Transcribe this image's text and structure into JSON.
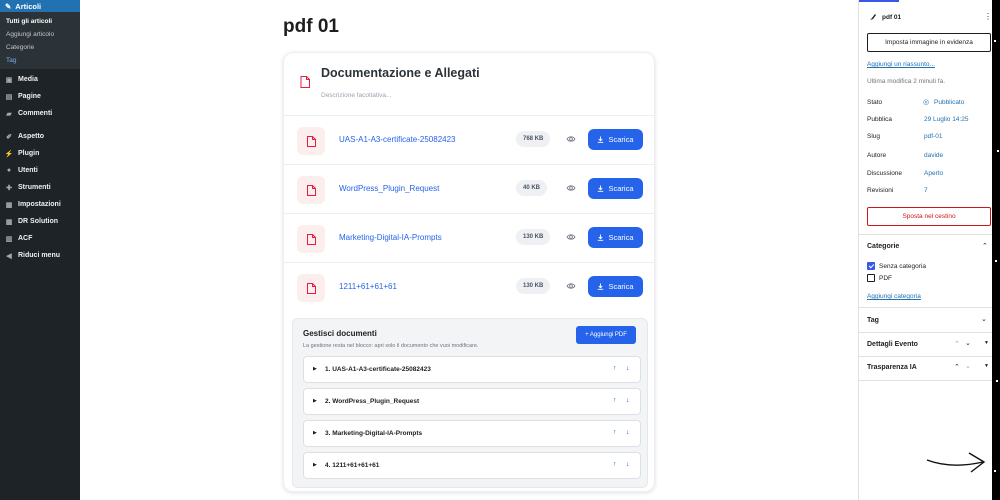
{
  "admin_menu": {
    "active": "Articoli",
    "submenu": [
      "Tutti gli articoli",
      "Aggiungi articolo",
      "Categorie",
      "Tag"
    ],
    "items": [
      "Media",
      "Pagine",
      "Commenti",
      "Aspetto",
      "Plugin",
      "Utenti",
      "Strumenti",
      "Impostazioni",
      "DR Solution",
      "ACF",
      "Riduci menu"
    ]
  },
  "editor": {
    "post_title": "pdf 01",
    "block": {
      "title": "Documentazione e Allegati",
      "description_placeholder": "Descrizione facoltativa...",
      "download_label": "Scarica",
      "files": [
        {
          "name": "UAS-A1-A3-certificate-25082423",
          "size": "768 KB"
        },
        {
          "name": "WordPress_Plugin_Request",
          "size": "40 KB"
        },
        {
          "name": "Marketing-Digital-IA-Prompts",
          "size": "130 KB"
        },
        {
          "name": "1211+61+61+61",
          "size": "130 KB"
        }
      ],
      "manage": {
        "title": "Gestisci documenti",
        "subtitle": "La gestione resta nel blocco: apri solo il documento che vuoi modificare.",
        "add_button": "+ Aggiungi PDF",
        "items": [
          "1. UAS-A1-A3-certificate-25082423",
          "2. WordPress_Plugin_Request",
          "3. Marketing-Digital-IA-Prompts",
          "4. 1211+61+61+61"
        ]
      }
    }
  },
  "panel": {
    "post_name": "pdf 01",
    "featured_image_button": "Imposta immagine in evidenza",
    "add_excerpt": "Aggiungi un riassunto...",
    "last_modified": "Ultima modifica 2 minuti fa.",
    "meta": [
      {
        "label": "Stato",
        "value": "Pubblicato"
      },
      {
        "label": "Pubblica",
        "value": "29 Luglio 14:25"
      },
      {
        "label": "Slug",
        "value": "pdf-01"
      },
      {
        "label": "Autore",
        "value": "davide"
      },
      {
        "label": "Discussione",
        "value": "Aperto"
      },
      {
        "label": "Revisioni",
        "value": "7"
      }
    ],
    "trash_button": "Sposta nel cestino",
    "categories_title": "Categorie",
    "categories": [
      {
        "name": "Senza categoria",
        "checked": true
      },
      {
        "name": "PDF",
        "checked": false
      }
    ],
    "add_category": "Aggiungi categoria",
    "tag_title": "Tag",
    "event_details_title": "Dettagli Evento",
    "transparency_title": "Trasparenza IA"
  },
  "colors": {
    "accent": "#2563eb",
    "wp_blue": "#3858e9",
    "danger": "#cc1818",
    "sidebar": "#1d2327"
  }
}
